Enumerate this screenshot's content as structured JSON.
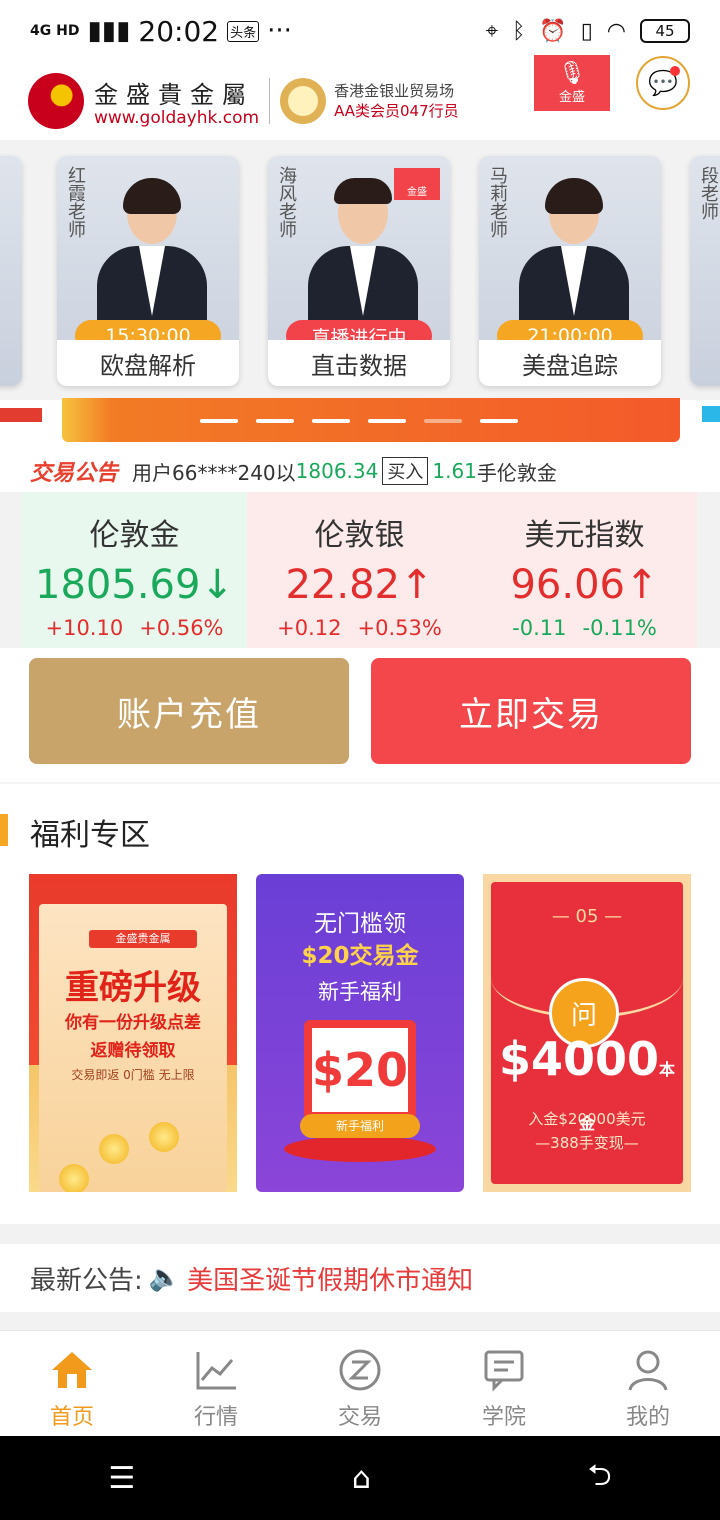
{
  "status": {
    "network": "4G HD",
    "time": "20:02",
    "app_tag": "头条",
    "more": "···",
    "battery": "45"
  },
  "header": {
    "brand_cn": "金盛貴金屬",
    "brand_url": "www.goldayhk.com",
    "member_line1": "香港金银业贸易场",
    "member_line2": "AA类会员047行员",
    "live_label": "金盛"
  },
  "teachers": [
    {
      "name": "红霞老师",
      "badge": "15:30:00",
      "topic": "欧盘解析",
      "live": false
    },
    {
      "name": "海风老师",
      "badge": "直播进行中",
      "topic": "直击数据",
      "live": true,
      "live_mark": "金盛"
    },
    {
      "name": "马莉老师",
      "badge": "21:00:00",
      "topic": "美盘追踪",
      "live": false
    },
    {
      "name": "段老师",
      "badge": "",
      "topic": "",
      "live": false
    }
  ],
  "ticker": {
    "tag": "交易公告",
    "prefix": "用户66****240以",
    "price": "1806.34",
    "action": "买入",
    "qty": "1.61",
    "suffix": "手伦敦金"
  },
  "quotes": [
    {
      "name": "伦敦金",
      "price": "1805.69",
      "arrow": "↓",
      "change": "+10.10",
      "percent": "+0.56%"
    },
    {
      "name": "伦敦银",
      "price": "22.82",
      "arrow": "↑",
      "change": "+0.12",
      "percent": "+0.53%"
    },
    {
      "name": "美元指数",
      "price": "96.06",
      "arrow": "↑",
      "change": "-0.11",
      "percent": "-0.11%"
    }
  ],
  "actions": {
    "deposit": "账户充值",
    "trade": "立即交易"
  },
  "welfare": {
    "title": "福利专区",
    "card1": {
      "tag": "金盛贵金属",
      "line1": "重磅升级",
      "line2": "你有一份升级点差",
      "line3": "返赠待领取",
      "line4": "交易即返  0门槛  无上限"
    },
    "card2": {
      "line1": "无门槛领",
      "line2": "$20交易金",
      "line3": "新手福利",
      "amount": "$20",
      "ribbon": "新手福利"
    },
    "card3": {
      "num": "— 05 —",
      "seal": "问",
      "amount": "$4000",
      "unit": "本金",
      "note1": "入金$20000美元",
      "note2": "—388手变现—"
    }
  },
  "notice": {
    "label": "最新公告:",
    "text": "美国圣诞节假期休市通知"
  },
  "tabs": [
    {
      "label": "首页",
      "icon": "home-icon"
    },
    {
      "label": "行情",
      "icon": "chart-icon"
    },
    {
      "label": "交易",
      "icon": "trade-icon"
    },
    {
      "label": "学院",
      "icon": "academy-icon"
    },
    {
      "label": "我的",
      "icon": "profile-icon"
    }
  ],
  "colors": {
    "accent": "#f29a1b",
    "up": "#e42d2d",
    "down": "#1aa85b",
    "deposit": "#c8a46a",
    "trade": "#f4474b"
  }
}
